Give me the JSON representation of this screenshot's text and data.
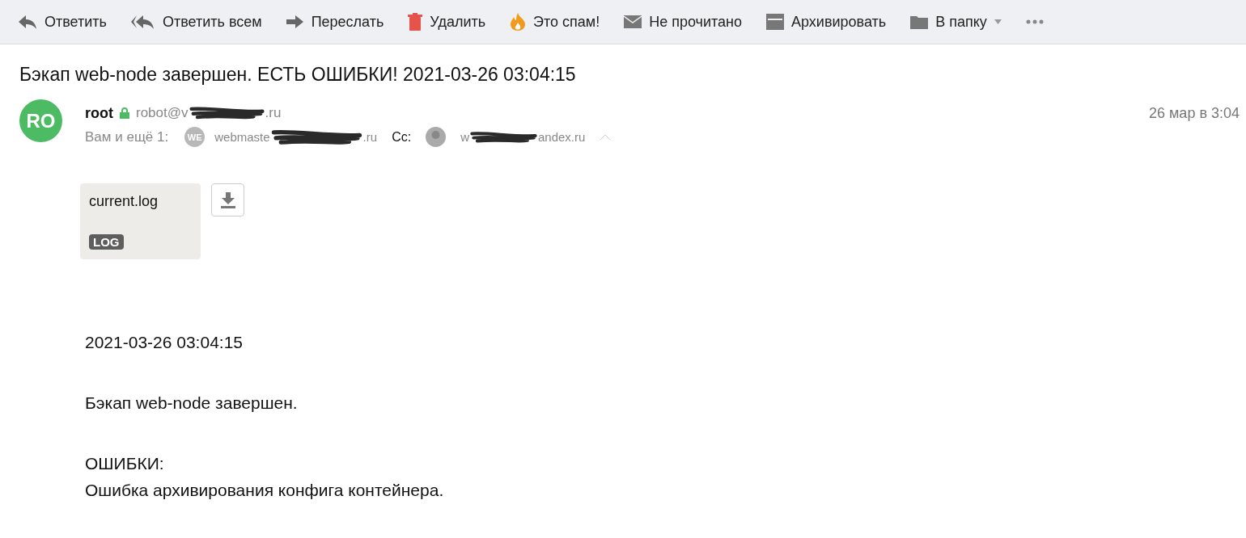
{
  "toolbar": [
    {
      "kind": "reply",
      "label": "Ответить"
    },
    {
      "kind": "reply-all",
      "label": "Ответить всем"
    },
    {
      "kind": "forward",
      "label": "Переслать"
    },
    {
      "kind": "delete",
      "label": "Удалить"
    },
    {
      "kind": "spam",
      "label": "Это спам!"
    },
    {
      "kind": "unread",
      "label": "Не прочитано"
    },
    {
      "kind": "archive",
      "label": "Архивировать"
    },
    {
      "kind": "folder",
      "label": "В папку",
      "dropdown": true
    },
    {
      "kind": "more"
    }
  ],
  "subject": "Бэкап web-node завершен. ЕСТЬ ОШИБКИ! 2021-03-26 03:04:15",
  "sender": {
    "initials": "RO",
    "name": "root",
    "email_start": "robot@v",
    "email_end": ".ru",
    "date": "26 мар в 3:04"
  },
  "recipients": {
    "label": "Вам и ещё 1:",
    "to": {
      "initials": "WE",
      "email_start": "webmaste",
      "email_end": ".ru"
    },
    "cc_label": "Cc:",
    "cc": {
      "email_start": "w",
      "email_end": "andex.ru"
    }
  },
  "attachment": {
    "name": "current.log",
    "type": "LOG"
  },
  "body": [
    "2021-03-26 03:04:15",
    "Бэкап web-node завершен.",
    "ОШИБКИ:\nОшибка архивирования конфига контейнера."
  ]
}
